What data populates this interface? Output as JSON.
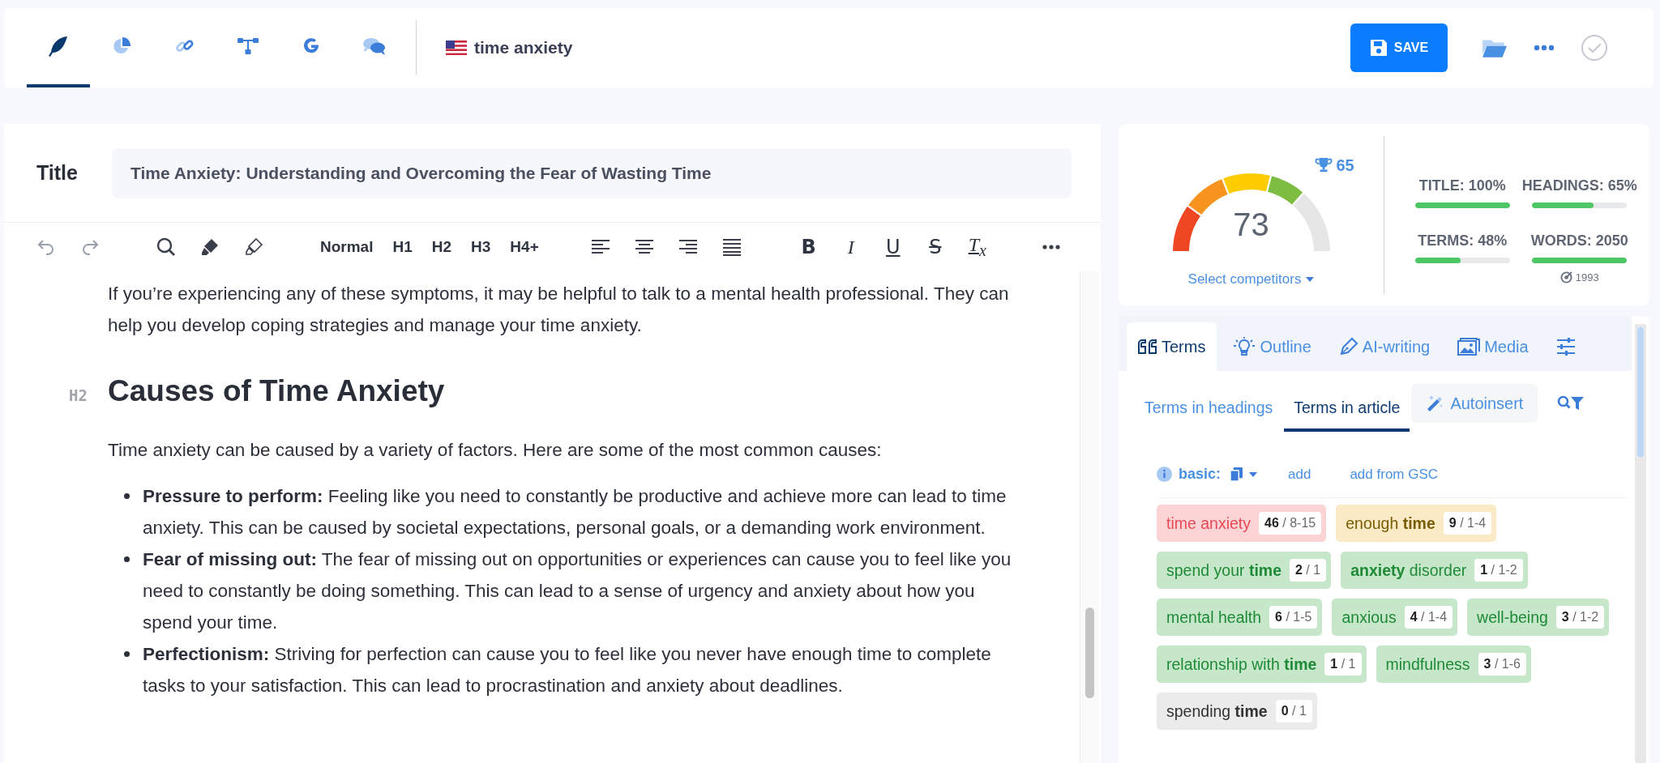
{
  "top_tabs": [
    {
      "selected": true
    },
    {
      "selected": false
    },
    {
      "selected": false
    },
    {
      "selected": false
    },
    {
      "selected": false
    },
    {
      "selected": false
    }
  ],
  "keyword": "time anxiety",
  "save_button": "SAVE",
  "title": {
    "label": "Title",
    "value": "Time Anxiety: Understanding and Overcoming the Fear of Wasting Time"
  },
  "toolbar": [
    {
      "kind": "icon",
      "disabled": true
    },
    {
      "kind": "icon",
      "disabled": true
    },
    {
      "kind": "gap"
    },
    {
      "kind": "icon",
      "disabled": false
    },
    {
      "kind": "icon",
      "disabled": false
    },
    {
      "kind": "icon",
      "disabled": false
    },
    {
      "kind": "gap"
    },
    {
      "kind": "text",
      "label": "Normal"
    },
    {
      "kind": "text",
      "label": "H1"
    },
    {
      "kind": "text",
      "label": "H2"
    },
    {
      "kind": "text",
      "label": "H3"
    },
    {
      "kind": "text",
      "label": "H4+"
    },
    {
      "kind": "gap"
    },
    {
      "kind": "icon",
      "disabled": false
    },
    {
      "kind": "icon",
      "disabled": false
    },
    {
      "kind": "icon",
      "disabled": false
    },
    {
      "kind": "icon",
      "disabled": false
    },
    {
      "kind": "gap"
    },
    {
      "kind": "format",
      "label": "B"
    },
    {
      "kind": "format",
      "label": "I"
    },
    {
      "kind": "format",
      "label": "U"
    },
    {
      "kind": "format",
      "label": "S"
    },
    {
      "kind": "format",
      "label": "T$_{x}$"
    },
    {
      "kind": "gap"
    },
    {
      "kind": "icon",
      "disabled": false
    }
  ],
  "content": [
    {
      "kind": "paragraph",
      "text": "If you’re experiencing any of these symptoms, it may be helpful to talk to a mental health professional. They can help you develop coping strategies and manage your time anxiety."
    },
    {
      "kind": "h2",
      "tag": "H2",
      "text": "Causes of Time Anxiety"
    },
    {
      "kind": "paragraph",
      "text": "Time anxiety can be caused by a variety of factors. Here are some of the most common causes:"
    },
    {
      "kind": "list",
      "items": [
        "**Pressure to perform:** Feeling like you need to constantly be productive and achieve more can lead to time anxiety. This can be caused by societal expectations, personal goals, or a demanding work environment.",
        "**Fear of missing out:** The fear of missing out on opportunities or experiences can cause you to feel like you need to constantly be doing something. This can lead to a sense of urgency and anxiety about how you spend your time.",
        "**Perfectionism:** Striving for perfection can cause you to feel like you never have enough time to complete tasks to your satisfaction. This can lead to procrastination and anxiety about deadlines."
      ]
    }
  ],
  "score": {
    "value": "73",
    "competitor_best": "65",
    "select_competitors": "Select competitors"
  },
  "metrics": [
    {
      "label": "TITLE: 100%",
      "level": 1
    },
    {
      "label": "HEADINGS: 65%",
      "level": 0.65
    },
    {
      "label": "TERMS: 48%",
      "level": 0.48
    },
    {
      "label": "WORDS: 2050",
      "level": 1,
      "target": "1993"
    }
  ],
  "panel_tabs": [
    {
      "label": "Terms",
      "selected": true
    },
    {
      "label": "Outline",
      "selected": false
    },
    {
      "label": "AI-writing",
      "selected": false
    },
    {
      "label": "Media",
      "selected": false
    },
    {
      "selected": false
    }
  ],
  "term_tabs": [
    {
      "label": "Terms in headings",
      "selected": false
    },
    {
      "label": "Terms in article",
      "selected": true
    }
  ],
  "autoinsert": "Autoinsert",
  "group": {
    "label": "basic:",
    "actions": [
      "add",
      "add from GSC"
    ]
  },
  "terms": [
    {
      "text": "time anxiety",
      "count": "**46** / 8-15",
      "kind": "over"
    },
    {
      "text": "enough **time**",
      "count": "**9** / 1-4",
      "kind": "warn"
    },
    {
      "text": "spend your **time**",
      "count": "**2** / 1",
      "kind": "ok"
    },
    {
      "text": "**anxiety** disorder",
      "count": "**1** / 1-2",
      "kind": "ok"
    },
    {
      "text": "mental health",
      "count": "**6** / 1-5",
      "kind": "ok"
    },
    {
      "text": "anxious",
      "count": "**4** / 1-4",
      "kind": "ok"
    },
    {
      "text": "well-being",
      "count": "**3** / 1-2",
      "kind": "ok"
    },
    {
      "text": "relationship with **time**",
      "count": "**1** / 1",
      "kind": "ok"
    },
    {
      "text": "mindfulness",
      "count": "**3** / 1-6",
      "kind": "ok"
    },
    {
      "text": "spending **time**",
      "count": "**0** / 1",
      "kind": "missing"
    }
  ]
}
